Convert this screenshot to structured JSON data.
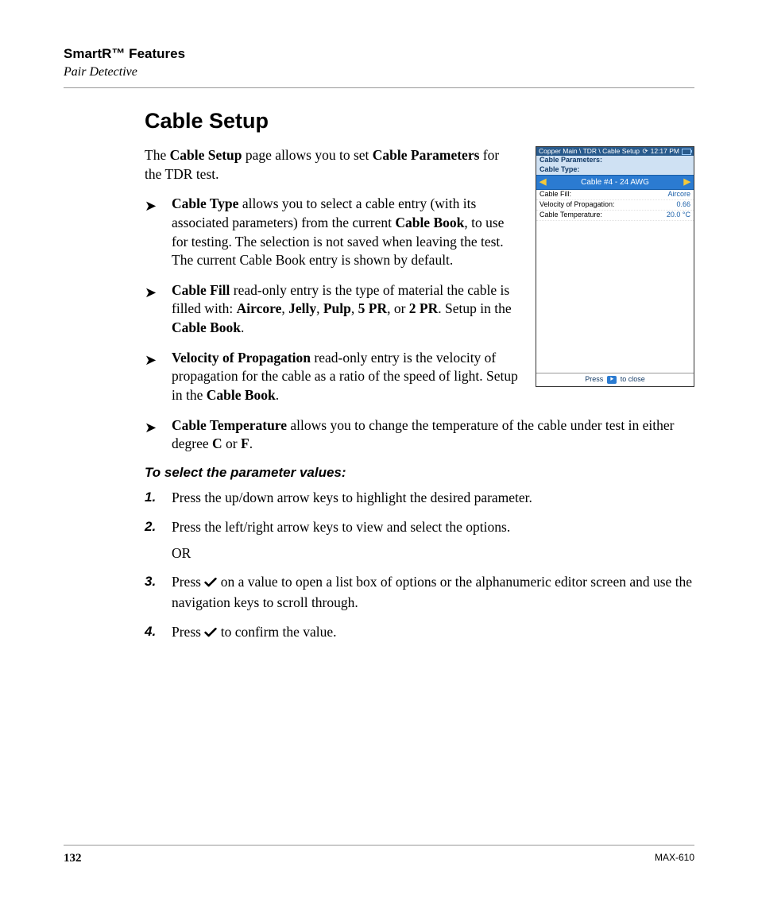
{
  "header": {
    "title": "SmartR™ Features",
    "subtitle": "Pair Detective"
  },
  "section": {
    "heading": "Cable Setup",
    "intro": {
      "pre": "The ",
      "b1": "Cable Setup",
      "mid": " page allows you to set ",
      "b2": "Cable Parameters",
      "post": " for the TDR test."
    },
    "bullets": {
      "cable_type": {
        "label": "Cable Type",
        "t1": " allows you to select a cable entry (with its associated parameters) from the current ",
        "b1": "Cable Book",
        "t2": ", to use for testing. The selection is not saved when leaving the test. The current Cable Book entry is shown by default."
      },
      "cable_fill": {
        "label": "Cable Fill",
        "t1": " read-only entry is the type of material the cable is filled with: ",
        "o1": "Aircore",
        "c1": ", ",
        "o2": "Jelly",
        "c2": ", ",
        "o3": "Pulp",
        "c3": ", ",
        "o4": "5 PR",
        "c4": ", or ",
        "o5": "2 PR",
        "c5": ". Setup in the ",
        "b1": "Cable Book",
        "c6": "."
      },
      "vop": {
        "label": "Velocity of Propagation",
        "t1": " read-only entry is the velocity of propagation for the cable as a ratio of the speed of light. Setup in the ",
        "b1": "Cable Book",
        "c1": "."
      },
      "temp": {
        "label": "Cable Temperature",
        "t1": " allows you to change the temperature of the cable under test in either degree ",
        "o1": "C",
        "c1": " or ",
        "o2": "F",
        "c2": "."
      }
    },
    "instructions": {
      "heading": "To select the parameter values:",
      "steps": {
        "s1": "Press the up/down arrow keys to highlight the desired parameter.",
        "s2": "Press the left/right arrow keys to view and select the options.",
        "or": "OR",
        "s3a": "Press ",
        "s3b": " on a value to open a list box of options or the alphanumeric editor screen and use the navigation keys to scroll through.",
        "s4a": "Press ",
        "s4b": " to confirm the value."
      },
      "nums": {
        "n1": "1.",
        "n2": "2.",
        "n3": "3.",
        "n4": "4."
      }
    }
  },
  "device": {
    "breadcrumb": "Copper Main \\ TDR \\ Cable Setup",
    "time": "12:17 PM",
    "section1": "Cable Parameters:",
    "section2": "Cable Type:",
    "selected": "Cable #4 - 24 AWG",
    "rows": [
      {
        "k": "Cable Fill:",
        "v": "Aircore"
      },
      {
        "k": "Velocity of Propagation:",
        "v": "0.66"
      },
      {
        "k": "Cable Temperature:",
        "v": "20.0 °C"
      }
    ],
    "footer_pre": "Press ",
    "footer_key": "⯈",
    "footer_post": " to close"
  },
  "footer": {
    "page": "132",
    "model": "MAX-610"
  }
}
